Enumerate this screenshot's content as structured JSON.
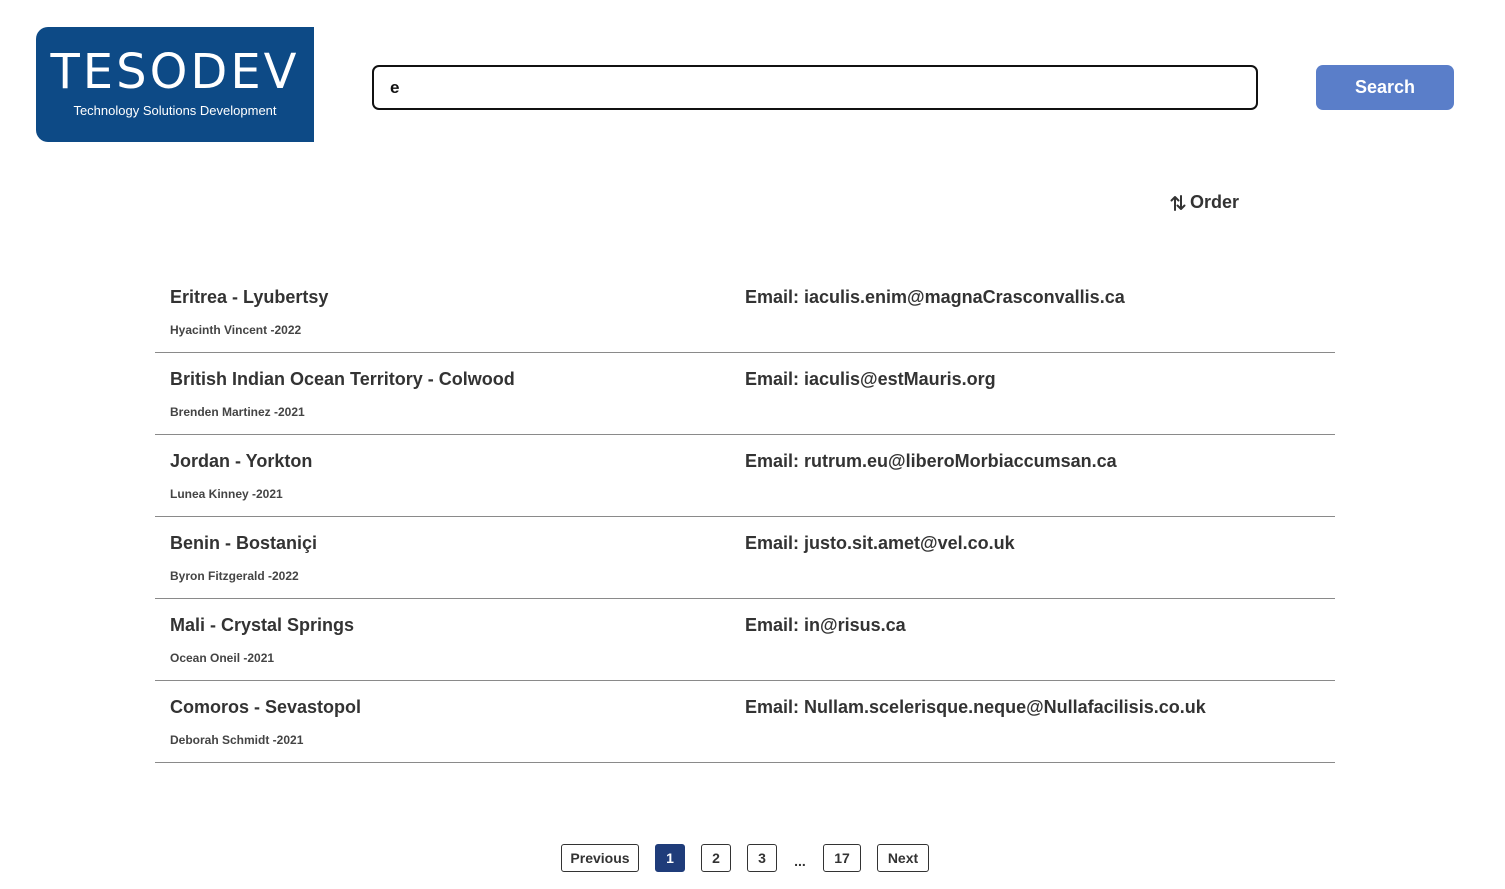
{
  "logo": {
    "wordmark": "TESODEV",
    "tagline": "Technology Solutions Development",
    "background_color": "#0d4a86"
  },
  "search": {
    "value": "e",
    "button_label": "Search",
    "button_color": "#5a7ec9"
  },
  "order": {
    "label": "Order",
    "icon": "sort-arrows-icon"
  },
  "results": [
    {
      "title": "Eritrea - Lyubertsy",
      "subtitle": "Hyacinth Vincent -2022",
      "email": "Email: iaculis.enim@magnaCrasconvallis.ca"
    },
    {
      "title": "British Indian Ocean Territory - Colwood",
      "subtitle": "Brenden Martinez -2021",
      "email": "Email: iaculis@estMauris.org"
    },
    {
      "title": "Jordan - Yorkton",
      "subtitle": "Lunea Kinney -2021",
      "email": "Email: rutrum.eu@liberoMorbiaccumsan.ca"
    },
    {
      "title": "Benin - Bostaniçi",
      "subtitle": "Byron Fitzgerald -2022",
      "email": "Email: justo.sit.amet@vel.co.uk"
    },
    {
      "title": "Mali - Crystal Springs",
      "subtitle": "Ocean Oneil -2021",
      "email": "Email: in@risus.ca"
    },
    {
      "title": "Comoros - Sevastopol",
      "subtitle": "Deborah Schmidt -2021",
      "email": "Email: Nullam.scelerisque.neque@Nullafacilisis.co.uk"
    }
  ],
  "pagination": {
    "previous": "Previous",
    "pages": [
      "1",
      "2",
      "3"
    ],
    "ellipsis": "...",
    "last_page": "17",
    "next": "Next",
    "current_page": "1",
    "active_color": "#1f3c7a"
  }
}
